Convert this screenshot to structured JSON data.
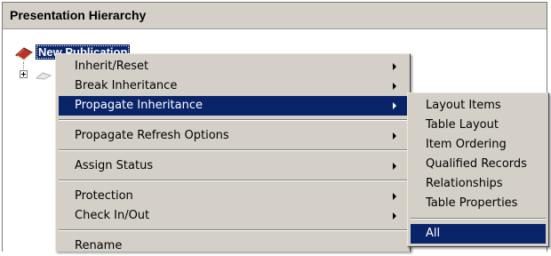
{
  "panel": {
    "title": "Presentation Hierarchy"
  },
  "tree": {
    "root_label": "New Publication",
    "root_icon": "book-icon",
    "expander_icon": "plus-expander-icon",
    "child_icon": "book-icon"
  },
  "context_menu": {
    "items": [
      {
        "label": "Inherit/Reset",
        "has_submenu": true
      },
      {
        "label": "Break Inheritance",
        "has_submenu": true
      },
      {
        "label": "Propagate Inheritance",
        "has_submenu": true,
        "selected": true
      },
      {
        "label": "Propagate Refresh Options",
        "has_submenu": true
      },
      {
        "label": "Assign Status",
        "has_submenu": true
      },
      {
        "label": "Protection",
        "has_submenu": true
      },
      {
        "label": "Check In/Out",
        "has_submenu": true
      },
      {
        "label": "Rename",
        "has_submenu": false
      }
    ]
  },
  "submenu": {
    "items": [
      {
        "label": "Layout Items"
      },
      {
        "label": "Table Layout"
      },
      {
        "label": "Item Ordering"
      },
      {
        "label": "Qualified Records"
      },
      {
        "label": "Relationships"
      },
      {
        "label": "Table Properties"
      },
      {
        "label": "All",
        "selected": true
      }
    ]
  },
  "colors": {
    "selection": "#0a246a",
    "menu_face": "#d4d0c8",
    "header_face": "#d4d0c8"
  }
}
